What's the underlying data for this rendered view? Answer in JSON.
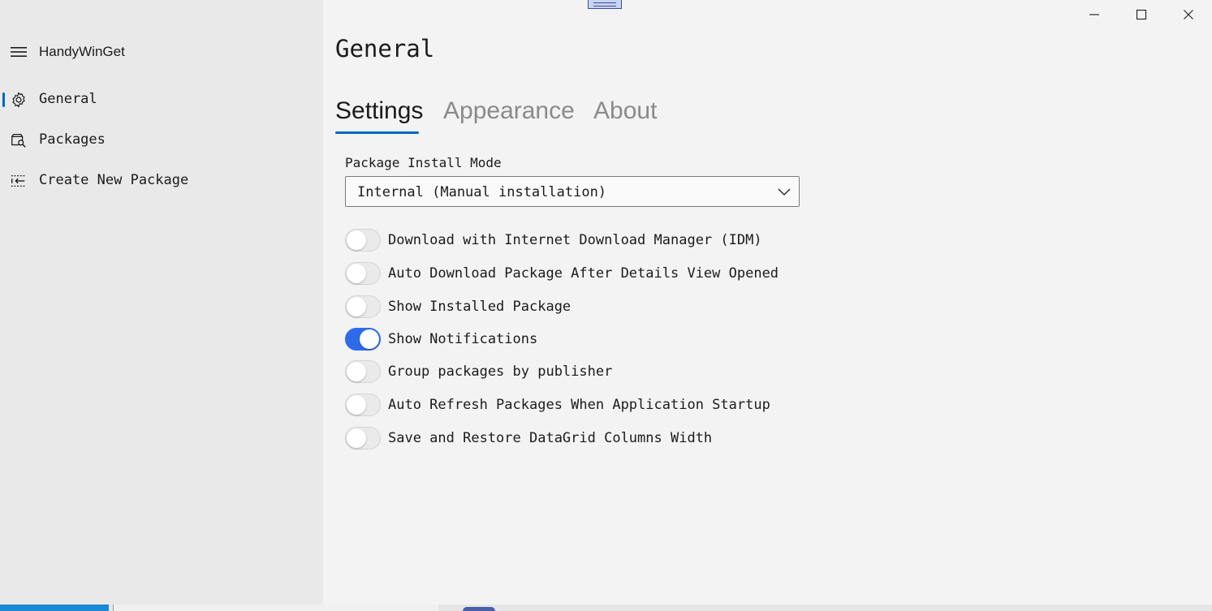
{
  "app": {
    "title": "HandyWinGet"
  },
  "sidebar": {
    "items": [
      {
        "label": "General",
        "icon": "gear-icon",
        "selected": true
      },
      {
        "label": "Packages",
        "icon": "package-search-icon",
        "selected": false
      },
      {
        "label": "Create New Package",
        "icon": "create-package-icon",
        "selected": false
      }
    ]
  },
  "main": {
    "page_title": "General",
    "tabs": [
      {
        "label": "Settings",
        "active": true
      },
      {
        "label": "Appearance",
        "active": false
      },
      {
        "label": "About",
        "active": false
      }
    ],
    "install_mode": {
      "label": "Package Install Mode",
      "value": "Internal (Manual installation)"
    },
    "toggles": [
      {
        "label": "Download with Internet Download Manager (IDM)",
        "on": false
      },
      {
        "label": "Auto Download Package After Details View Opened",
        "on": false
      },
      {
        "label": "Show Installed Package",
        "on": false
      },
      {
        "label": "Show Notifications",
        "on": true
      },
      {
        "label": "Group packages by publisher",
        "on": false
      },
      {
        "label": "Auto Refresh Packages When Application Startup",
        "on": false
      },
      {
        "label": "Save and Restore DataGrid Columns Width",
        "on": false
      }
    ]
  },
  "colors": {
    "accent": "#0067c0",
    "toggle_on": "#2f6be8",
    "sidebar_bg": "#e9e9e9",
    "content_bg": "#f3f3f3"
  }
}
